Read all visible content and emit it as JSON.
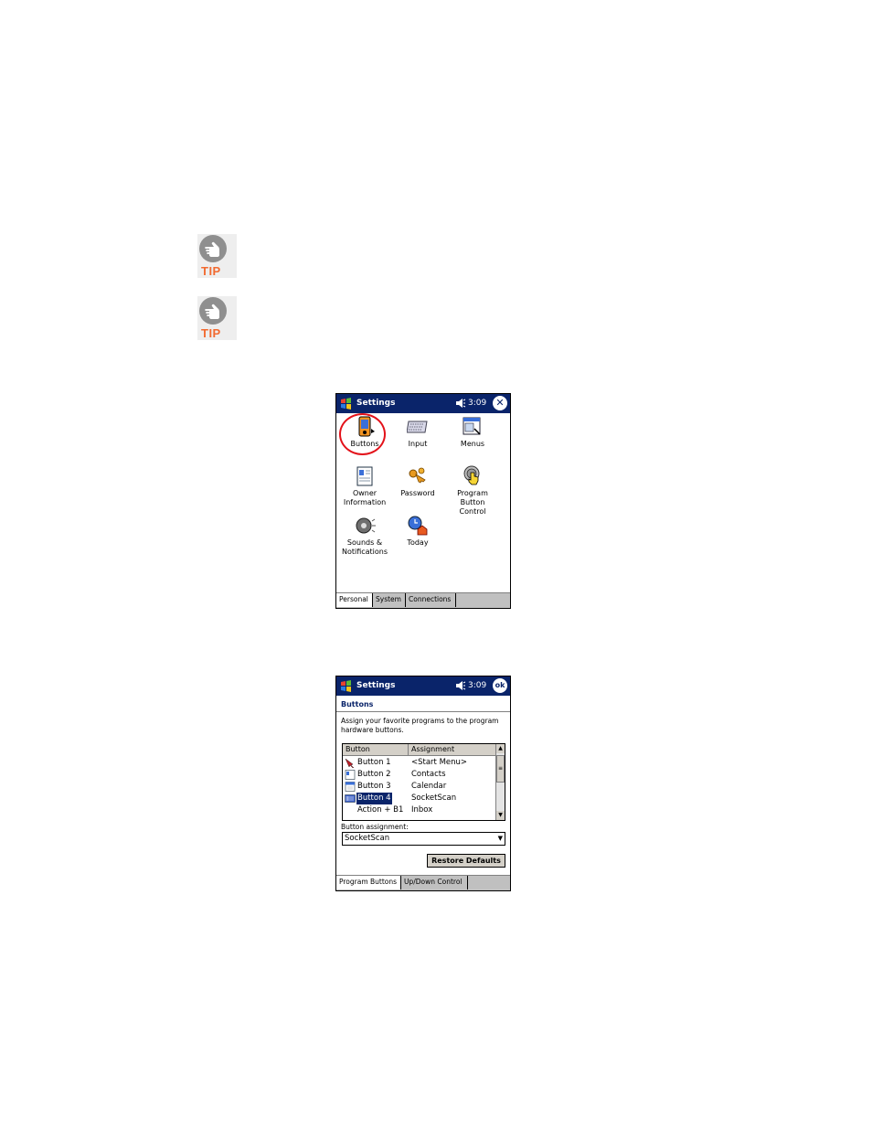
{
  "tips": [
    {
      "label": "TIP"
    },
    {
      "label": "TIP"
    }
  ],
  "screen1": {
    "title": "Settings",
    "time": "3:09",
    "icons": [
      {
        "label": "Buttons"
      },
      {
        "label": "Input"
      },
      {
        "label": "Menus"
      },
      {
        "label": "Owner\nInformation"
      },
      {
        "label": "Password"
      },
      {
        "label": "Program\nButton\nControl"
      },
      {
        "label": "Sounds &\nNotifications"
      },
      {
        "label": "Today"
      }
    ],
    "tabs": [
      "Personal",
      "System",
      "Connections"
    ],
    "highlight_color": "#e3121a"
  },
  "screen2": {
    "title": "Settings",
    "time": "3:09",
    "ok": "ok",
    "heading": "Buttons",
    "description": "Assign your favorite programs to the program hardware buttons.",
    "columns": [
      "Button",
      "Assignment"
    ],
    "rows": [
      {
        "button": "Button 1",
        "assignment": "<Start Menu>"
      },
      {
        "button": "Button 2",
        "assignment": "Contacts"
      },
      {
        "button": "Button 3",
        "assignment": "Calendar"
      },
      {
        "button": "Button 4",
        "assignment": "SocketScan"
      },
      {
        "button": "Action + B1",
        "assignment": "Inbox"
      }
    ],
    "assignment_label": "Button assignment:",
    "assignment_value": "SocketScan",
    "restore_label": "Restore Defaults",
    "tabs": [
      "Program Buttons",
      "Up/Down Control"
    ]
  }
}
